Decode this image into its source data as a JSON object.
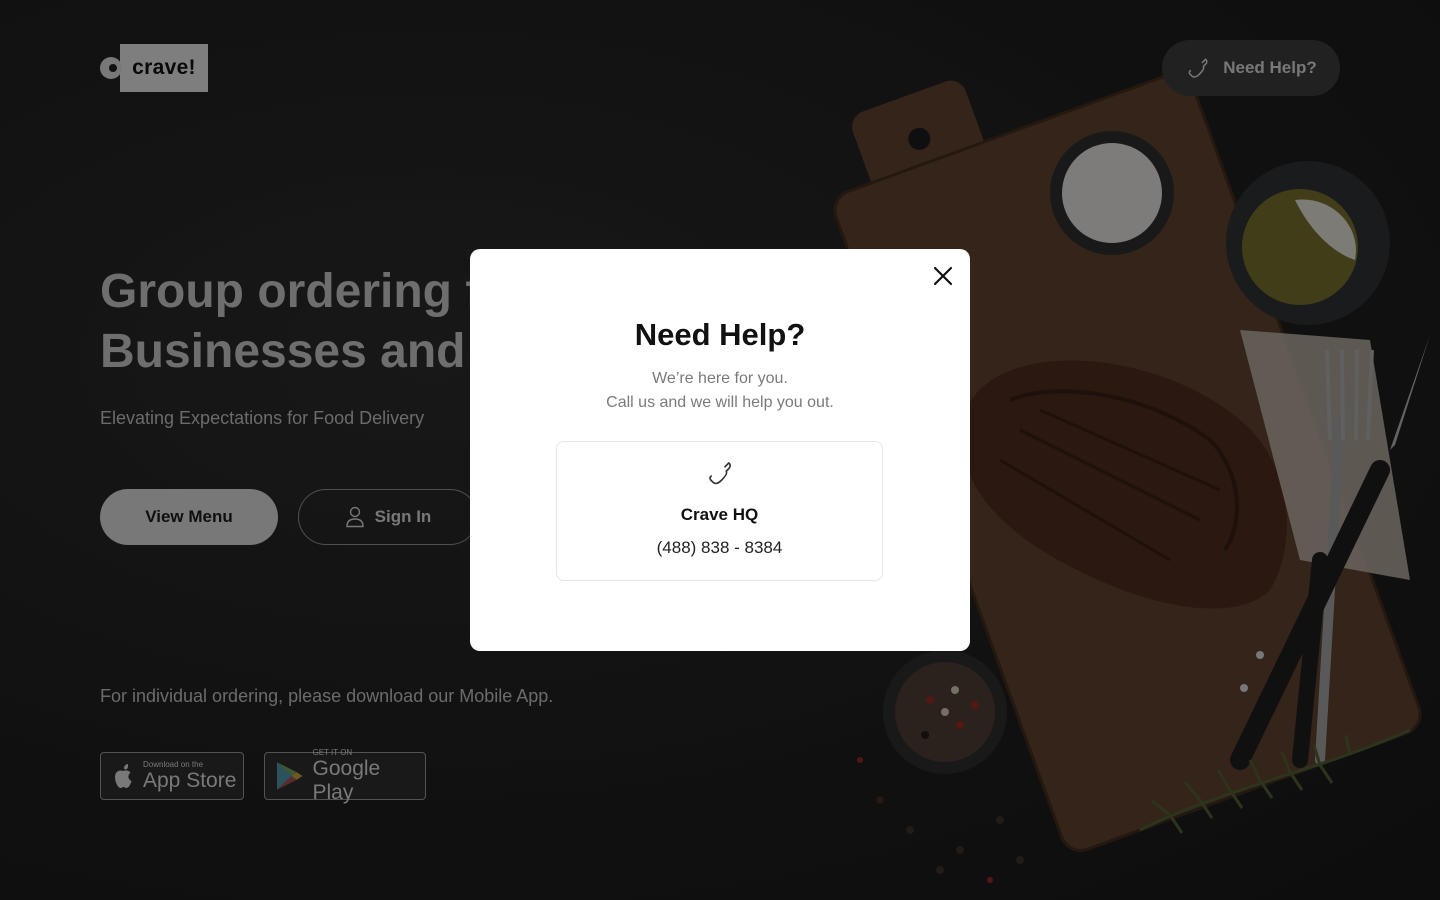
{
  "header": {
    "logo_text": "crave!",
    "help_button_label": "Need Help?"
  },
  "hero": {
    "title_line1": "Group ordering for",
    "title_line2": "Businesses and Teams",
    "subtitle": "Elevating Expectations for Food Delivery",
    "view_menu_label": "View Menu",
    "sign_in_label": "Sign In"
  },
  "app_download": {
    "text": "For individual ordering, please download our Mobile App.",
    "apple_small": "Download on the",
    "apple_big": "App Store",
    "google_small": "GET IT ON",
    "google_big": "Google Play"
  },
  "modal": {
    "title": "Need Help?",
    "line1": "We’re here for you.",
    "line2": "Call us and we will help you out.",
    "contact": {
      "name": "Crave HQ",
      "phone": "(488) 838 - 8384"
    }
  },
  "icons": {
    "phone": "phone-icon",
    "user": "user-icon",
    "close": "close-icon",
    "apple": "apple-icon",
    "google_play": "google-play-icon"
  }
}
